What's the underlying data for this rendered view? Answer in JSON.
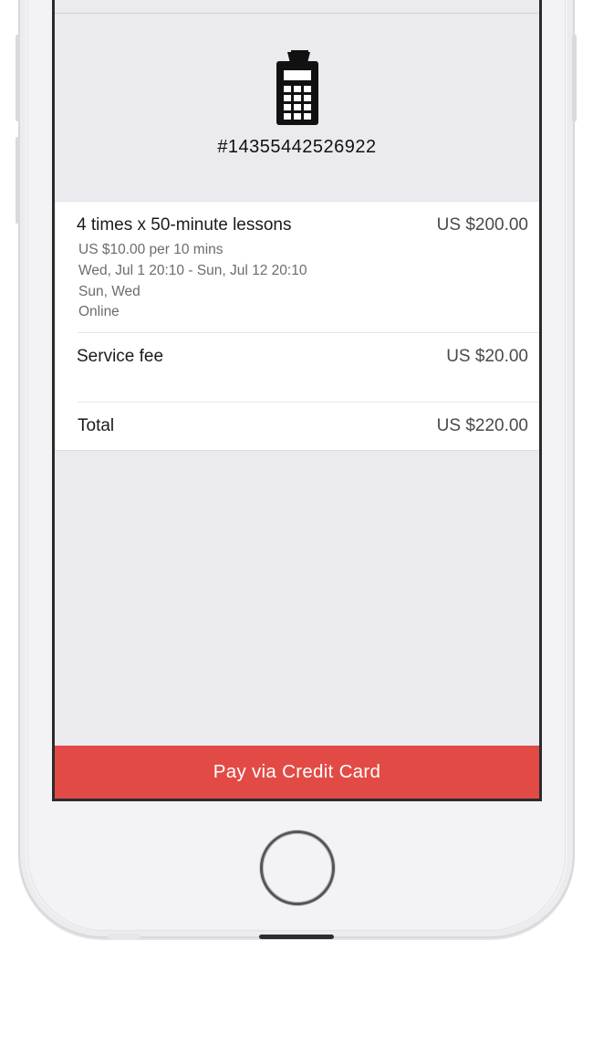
{
  "receipt": {
    "icon": "payment-terminal-icon",
    "order_number": "#14355442526922"
  },
  "line_items": [
    {
      "title": "4 times x 50-minute lessons",
      "price": "US $200.00",
      "details": [
        "US $10.00 per 10 mins",
        "Wed, Jul 1 20:10 - Sun, Jul 12 20:10",
        "Sun, Wed",
        "Online"
      ]
    },
    {
      "title": "Service fee",
      "price": "US $20.00"
    }
  ],
  "total": {
    "label": "Total",
    "price": "US $220.00"
  },
  "pay_button": {
    "label": "Pay via Credit Card",
    "color": "#e24b45"
  }
}
